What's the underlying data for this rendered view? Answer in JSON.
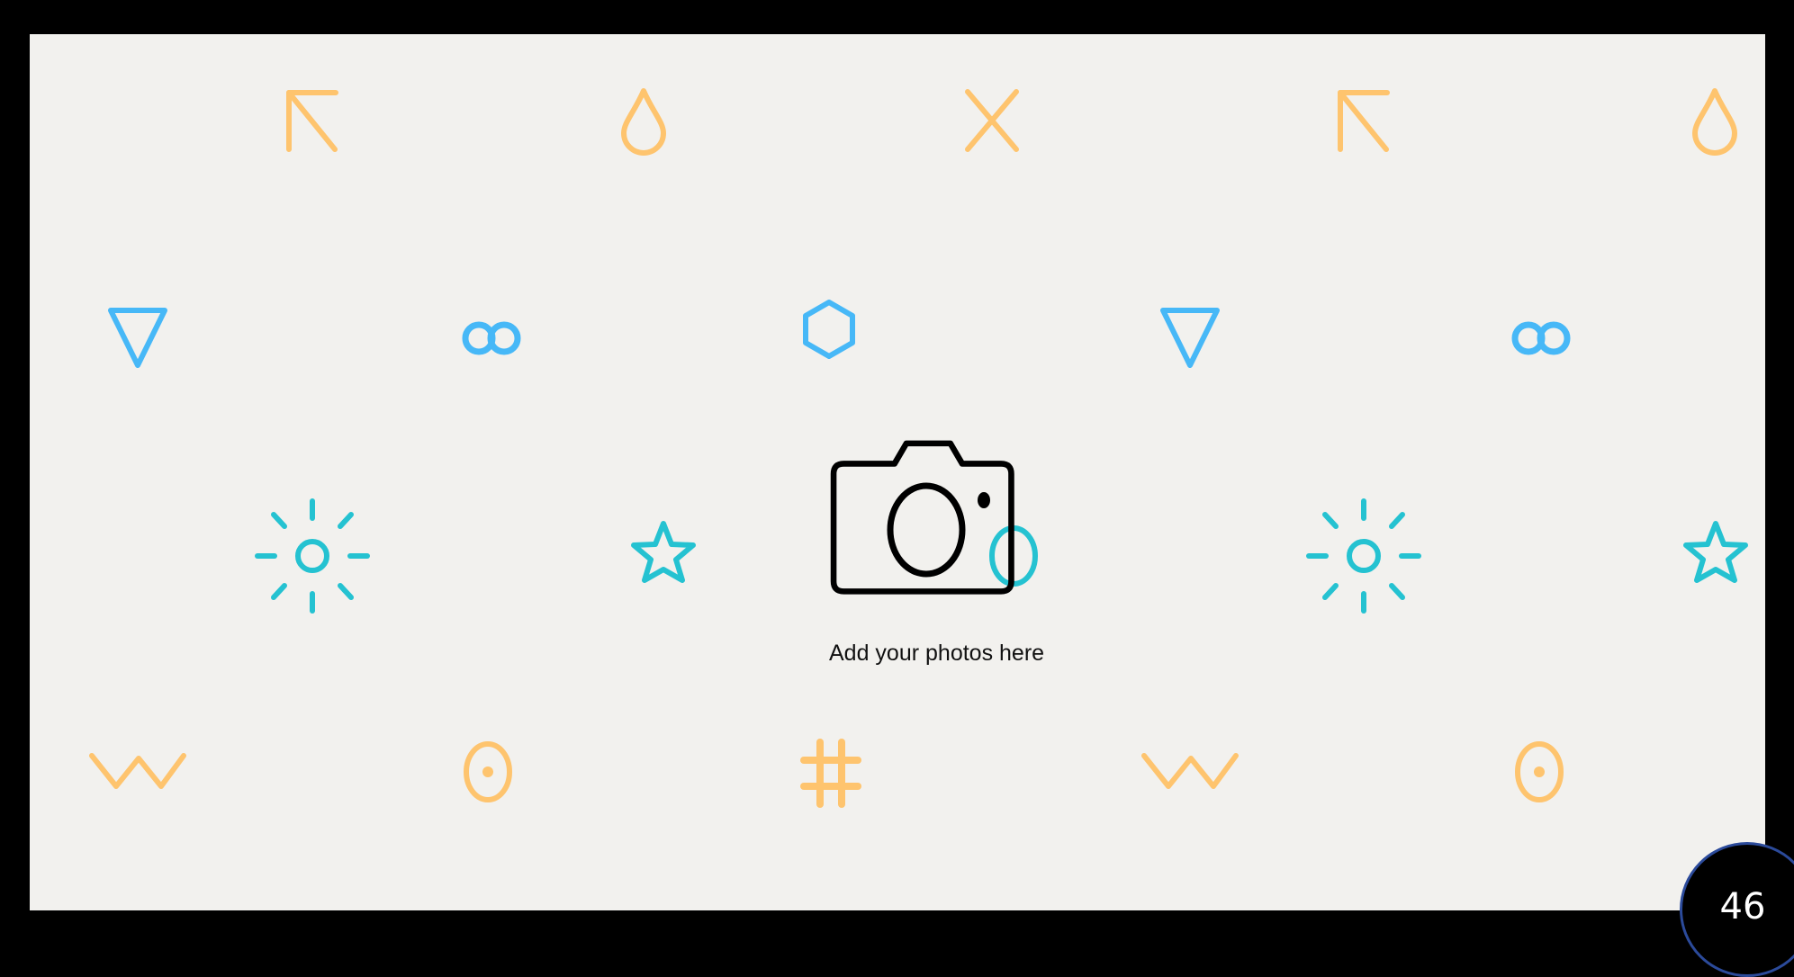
{
  "slide": {
    "photo_placeholder_label": "Add your photos here",
    "page_number": "46"
  },
  "colors": {
    "frame": "#000000",
    "canvas": "#f2f1ee",
    "orange": "#fec46e",
    "blue": "#47b8f7",
    "teal": "#25c2d1",
    "camera": "#000000",
    "badge_border": "#2b4a9a"
  },
  "pattern_icons": [
    "arrow-up-left-icon",
    "droplet-icon",
    "x-icon",
    "arrow-up-left-icon",
    "droplet-icon",
    "triangle-down-icon",
    "infinity-icon",
    "hexagon-icon",
    "triangle-down-icon",
    "infinity-icon",
    "sun-icon",
    "star-icon",
    "circle-icon",
    "sun-icon",
    "star-icon",
    "zigzag-icon",
    "target-icon",
    "hash-icon",
    "zigzag-icon",
    "target-icon"
  ]
}
